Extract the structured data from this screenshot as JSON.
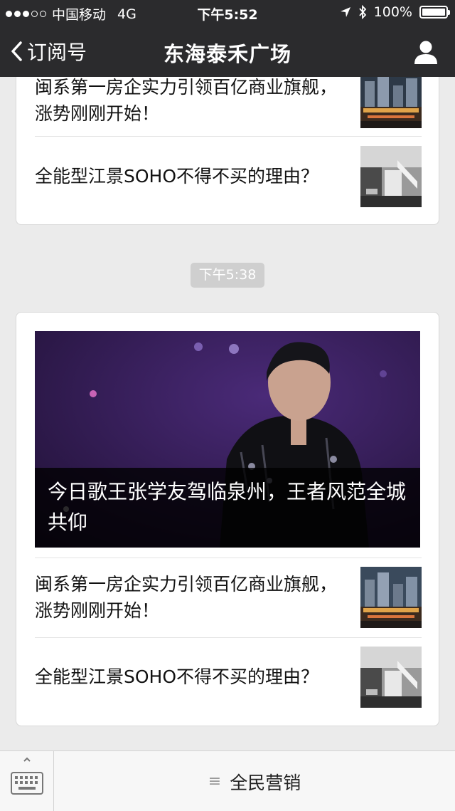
{
  "status_bar": {
    "carrier": "中国移动",
    "network": "4G",
    "time": "下午5:52",
    "battery": "100%",
    "battery_level": 1.0,
    "signal_bars_filled": 3,
    "signal_bars_total": 5
  },
  "nav": {
    "back_label": "订阅号",
    "title": "东海泰禾广场"
  },
  "first_message": {
    "articles": [
      {
        "title": "闽系第一房企实力引领百亿商业旗舰，涨势刚刚开始！",
        "thumb": "building-night-thumbnail"
      },
      {
        "title": "全能型江景SOHO不得不买的理由？",
        "thumb": "office-interior-thumbnail"
      }
    ]
  },
  "timestamp": "下午5:38",
  "second_message": {
    "hero": {
      "title": "今日歌王张学友驾临泉州，王者风范全城共仰",
      "image": "concert-singer-photo"
    },
    "articles": [
      {
        "title": "闽系第一房企实力引领百亿商业旗舰，涨势刚刚开始！",
        "thumb": "building-night-thumbnail"
      },
      {
        "title": "全能型江景SOHO不得不买的理由？",
        "thumb": "office-interior-thumbnail"
      }
    ]
  },
  "bottom_bar": {
    "keyboard_icon": "keyboard-icon",
    "menu_label": "全民营销",
    "menu_icon": "hamburger-icon"
  },
  "colors": {
    "bar_background": "#2b2b2d",
    "page_background": "#ebebeb",
    "timestamp_badge": "#cfcfcf"
  }
}
